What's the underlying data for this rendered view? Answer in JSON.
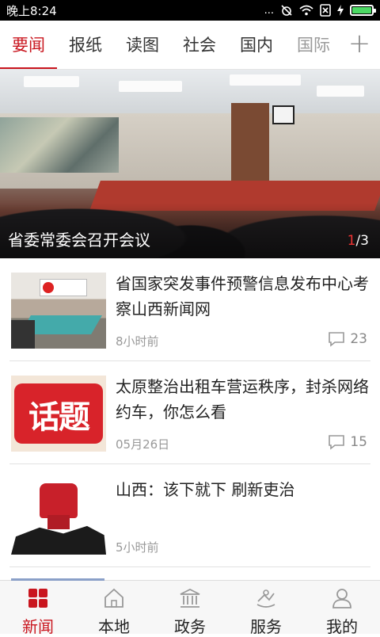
{
  "status_bar": {
    "time": "晚上8:24",
    "signal_text": "...",
    "battery_level": 1.0
  },
  "tabs": [
    {
      "label": "要闻",
      "active": true
    },
    {
      "label": "报纸"
    },
    {
      "label": "读图"
    },
    {
      "label": "社会"
    },
    {
      "label": "国内"
    },
    {
      "label": "国际"
    }
  ],
  "tab_add_symbol": "+",
  "banner": {
    "caption": "省委常委会召开会议",
    "current": "1",
    "separator": "/",
    "total": "3"
  },
  "feed": [
    {
      "title": "省国家突发事件预警信息发布中心考察山西新闻网",
      "time": "8小时前",
      "comments": "23",
      "thumb": "meeting-room"
    },
    {
      "title": "太原整治出租车营运秩序，封杀网络约车，你怎么看",
      "time": "05月26日",
      "comments": "15",
      "thumb_text": "话题"
    },
    {
      "title": "山西：该下就下 刷新吏治",
      "time": "5小时前",
      "thumb": "red-fist"
    }
  ],
  "bottom_nav": [
    {
      "label": "新闻",
      "icon": "grid-icon",
      "active": true
    },
    {
      "label": "本地",
      "icon": "home-icon"
    },
    {
      "label": "政务",
      "icon": "government-building-icon"
    },
    {
      "label": "服务",
      "icon": "service-icon"
    },
    {
      "label": "我的",
      "icon": "user-icon"
    }
  ],
  "colors": {
    "accent": "#c9151e",
    "status_bar": "#000000",
    "battery": "#4cd964"
  }
}
